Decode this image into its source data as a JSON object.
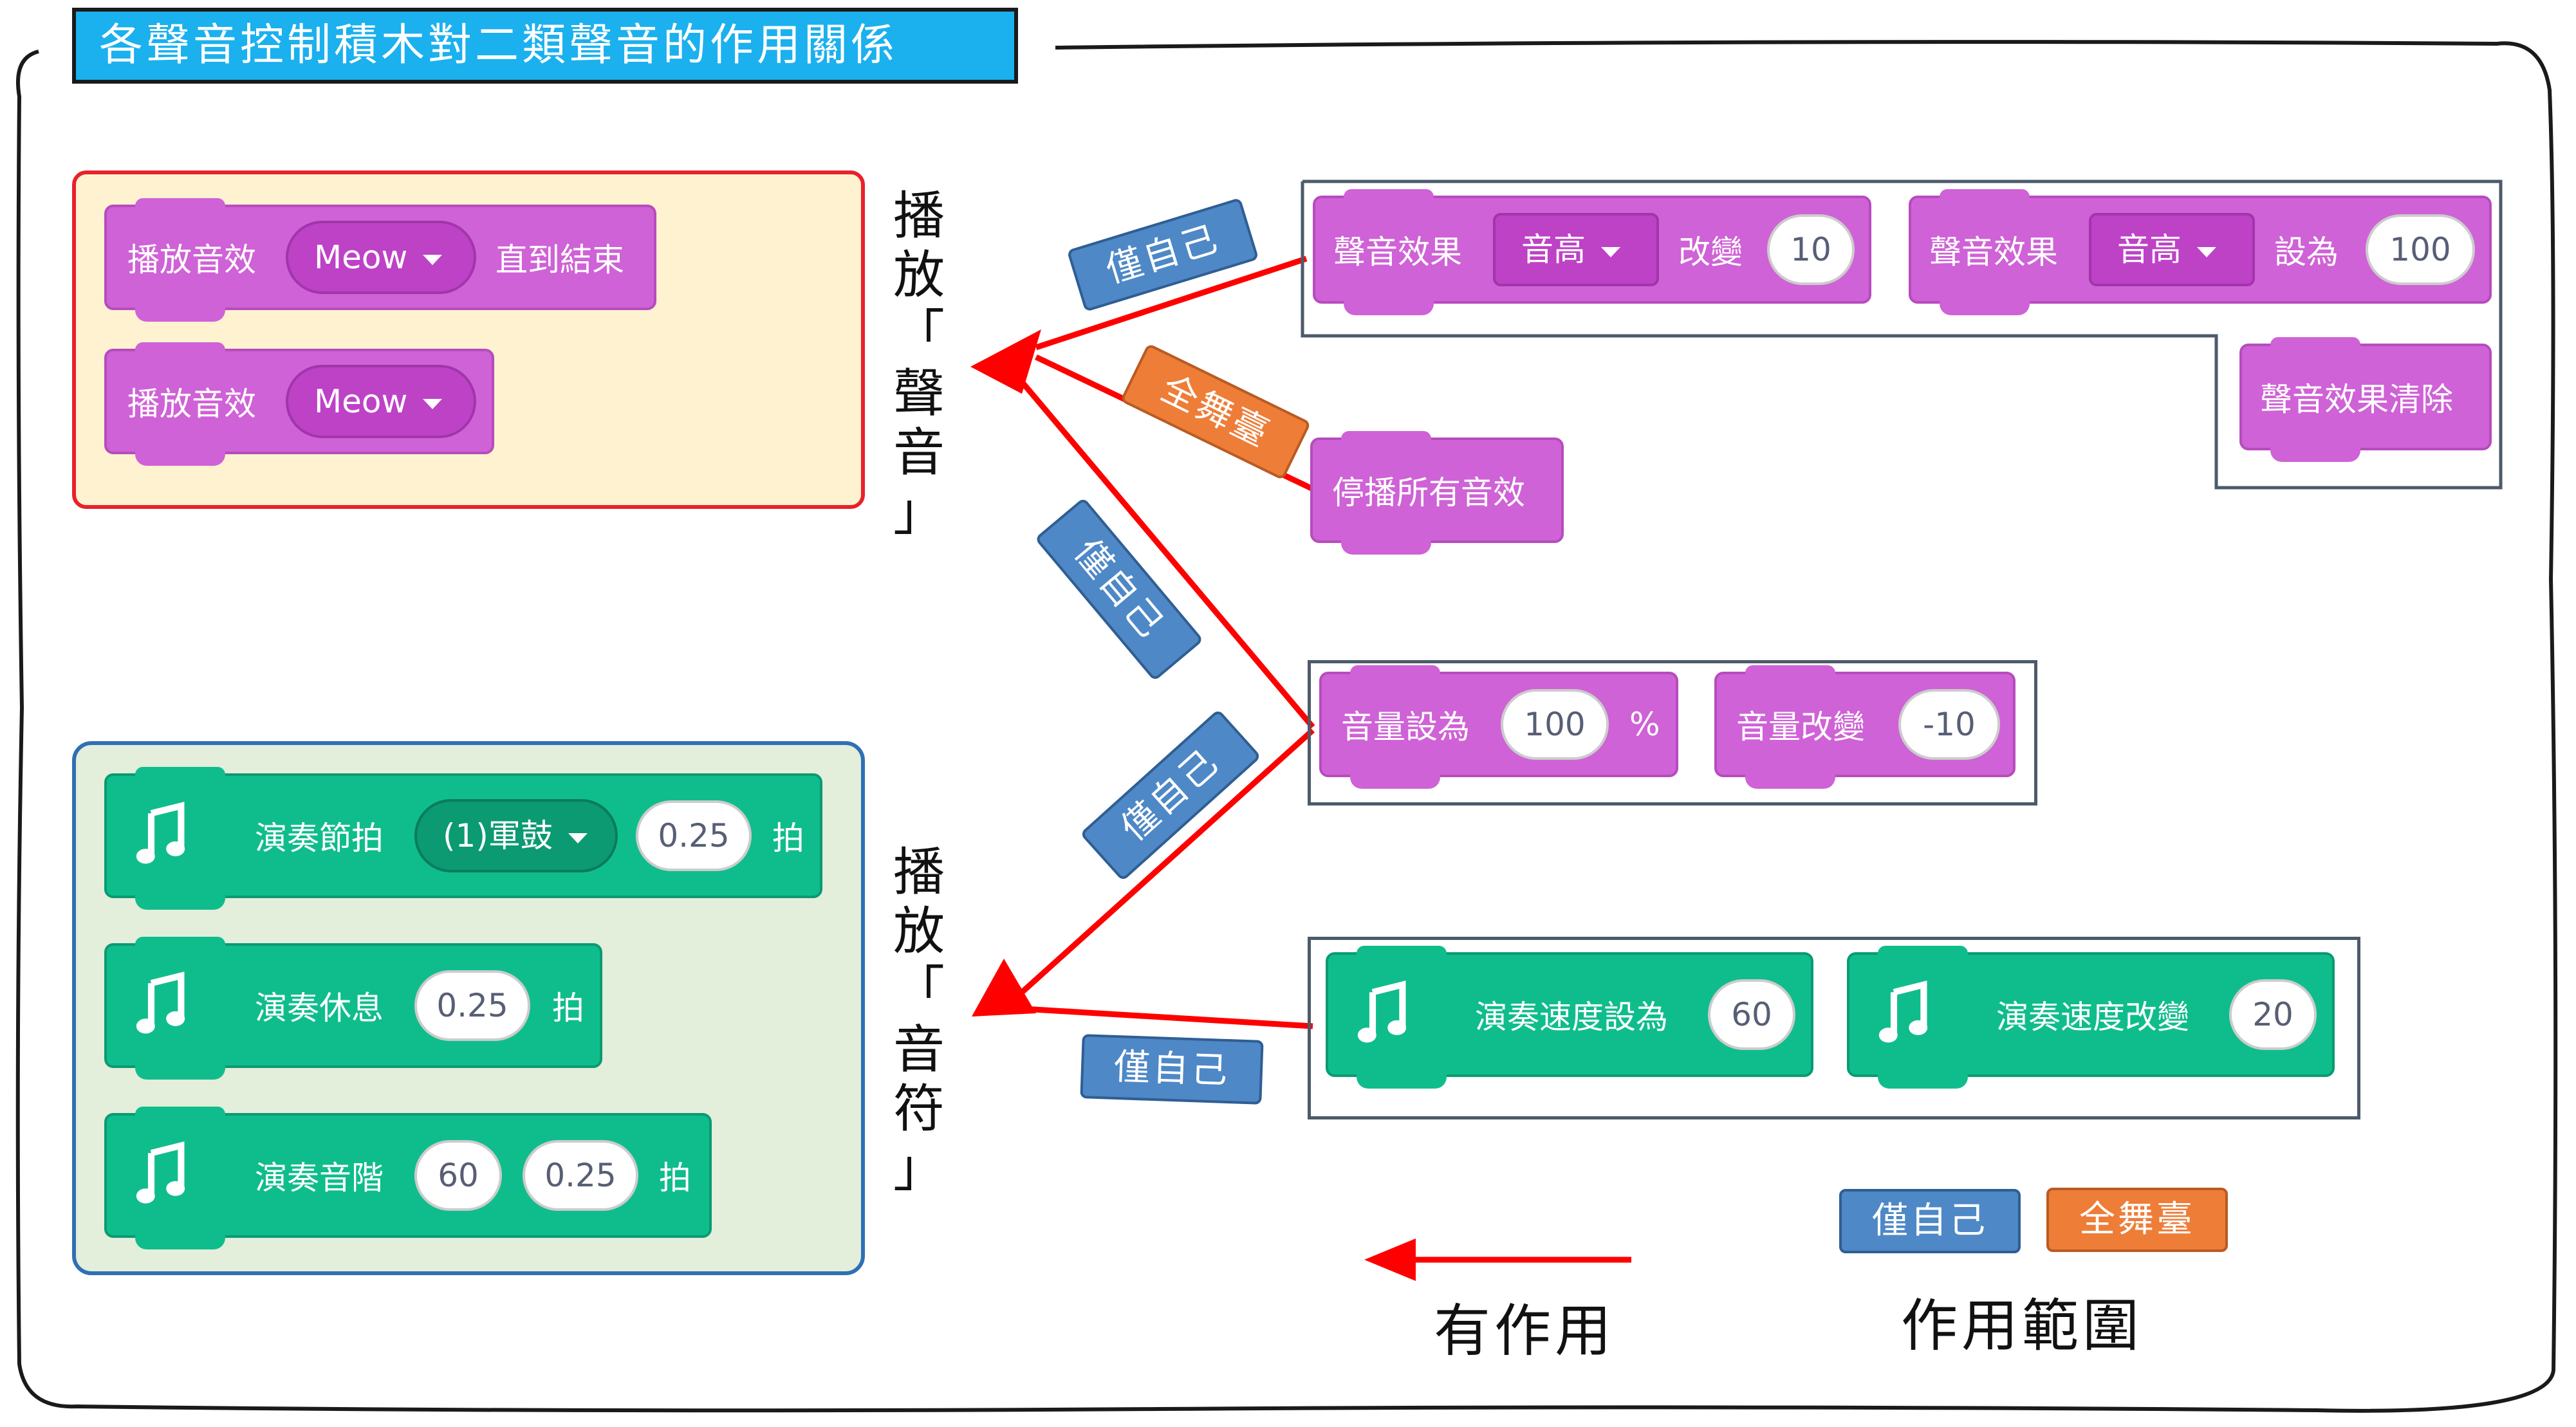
{
  "title": "各聲音控制積木對二類聲音的作用關係",
  "labels": {
    "play_sound": [
      "播",
      "放",
      "「",
      "聲",
      "音",
      "」"
    ],
    "play_note": [
      "播",
      "放",
      "「",
      "音",
      "符",
      "」"
    ]
  },
  "sound_blocks": [
    {
      "text": "播放音效",
      "menu": "Meow",
      "suffix": "直到結束"
    },
    {
      "text": "播放音效",
      "menu": "Meow"
    }
  ],
  "note_blocks": [
    {
      "text": "演奏節拍",
      "menu": "(1)軍鼓",
      "value": "0.25",
      "suffix": "拍"
    },
    {
      "text": "演奏休息",
      "value": "0.25",
      "suffix": "拍"
    },
    {
      "text": "演奏音階",
      "value1": "60",
      "value2": "0.25",
      "suffix": "拍"
    }
  ],
  "effect_blocks": [
    {
      "text": "聲音效果",
      "menu": "音高",
      "verb": "改變",
      "value": "10"
    },
    {
      "text": "聲音效果",
      "menu": "音高",
      "verb": "設為",
      "value": "100"
    },
    {
      "text": "聲音效果清除"
    }
  ],
  "stop_block": {
    "text": "停播所有音效"
  },
  "volume_blocks": [
    {
      "text": "音量設為",
      "value": "100",
      "suffix": "%"
    },
    {
      "text": "音量改變",
      "value": "-10"
    }
  ],
  "tempo_blocks": [
    {
      "text": "演奏速度設為",
      "value": "60"
    },
    {
      "text": "演奏速度改變",
      "value": "20"
    }
  ],
  "badges": {
    "self": "僅自己",
    "stage": "全舞臺"
  },
  "legend": {
    "arrow_label": "有作用",
    "scope_label": "作用範圍"
  },
  "colors": {
    "sound_block": "#cf62d6",
    "note_block": "#0fbd8c",
    "arrow": "#ff0000",
    "badge_self": "#4e88c6",
    "badge_stage": "#ee7d38",
    "title_bg": "#1bb0ee"
  }
}
